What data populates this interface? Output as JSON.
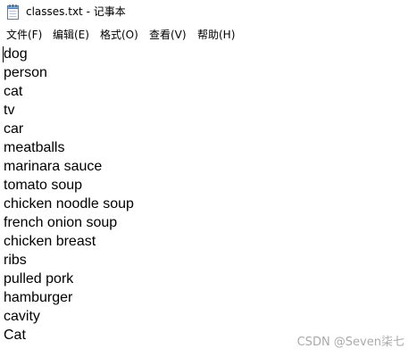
{
  "window": {
    "title": "classes.txt - 记事本",
    "icon": "notepad-icon"
  },
  "menu": {
    "items": [
      {
        "label": "文件(F)"
      },
      {
        "label": "编辑(E)"
      },
      {
        "label": "格式(O)"
      },
      {
        "label": "查看(V)"
      },
      {
        "label": "帮助(H)"
      }
    ]
  },
  "editor": {
    "lines": [
      "dog",
      "person",
      "cat",
      "tv",
      "car",
      "meatballs",
      "marinara sauce",
      "tomato soup",
      "chicken noodle soup",
      "french onion soup",
      "chicken breast",
      "ribs",
      "pulled pork",
      "hamburger",
      "cavity",
      "Cat"
    ]
  },
  "watermark": {
    "text": "CSDN @Seven柒七"
  }
}
